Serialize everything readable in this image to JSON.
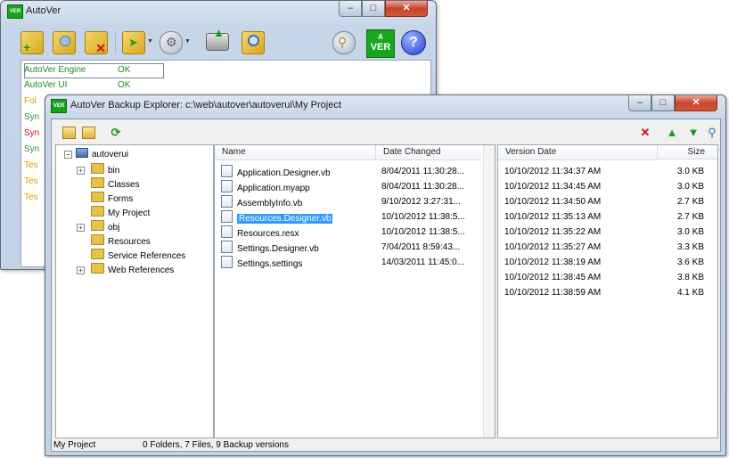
{
  "main_window": {
    "title": "AutoVer",
    "ver_badge": "VER",
    "ver_badge_small": "A",
    "status": [
      {
        "label": "AutoVer Engine",
        "value": "OK"
      },
      {
        "label": "AutoVer UI",
        "value": "OK"
      }
    ],
    "log_lines": [
      "Fol",
      "Syn",
      "Syn",
      "Syn",
      "Tes",
      "Tes",
      "Tes"
    ],
    "log_colors": [
      "#d9a400",
      "#2e8b2e",
      "#d01010",
      "#2e8b2e",
      "#d9a400",
      "#d9a400",
      "#d9a400"
    ]
  },
  "explorer": {
    "title": "AutoVer Backup Explorer: c:\\web\\autover\\autoverui\\My Project",
    "tree": {
      "root": "autoverui",
      "items": [
        {
          "label": "bin",
          "expandable": true
        },
        {
          "label": "Classes",
          "expandable": false
        },
        {
          "label": "Forms",
          "expandable": false
        },
        {
          "label": "My Project",
          "expandable": false
        },
        {
          "label": "obj",
          "expandable": true
        },
        {
          "label": "Resources",
          "expandable": false
        },
        {
          "label": "Service References",
          "expandable": false
        },
        {
          "label": "Web References",
          "expandable": true
        }
      ]
    },
    "files": {
      "col_name": "Name",
      "col_date": "Date Changed",
      "rows": [
        {
          "name": "Application.Designer.vb",
          "date": "8/04/2011 11:30:28..."
        },
        {
          "name": "Application.myapp",
          "date": "8/04/2011 11:30:28..."
        },
        {
          "name": "AssemblyInfo.vb",
          "date": "9/10/2012 3:27:31..."
        },
        {
          "name": "Resources.Designer.vb",
          "date": "10/10/2012 11:38:5..."
        },
        {
          "name": "Resources.resx",
          "date": "10/10/2012 11:38:5..."
        },
        {
          "name": "Settings.Designer.vb",
          "date": "7/04/2011 8:59:43..."
        },
        {
          "name": "Settings.settings",
          "date": "14/03/2011 11:45:0..."
        }
      ],
      "selected_index": 3
    },
    "versions": {
      "col_date": "Version Date",
      "col_size": "Size",
      "rows": [
        {
          "date": "10/10/2012 11:34:37 AM",
          "size": "3.0 KB"
        },
        {
          "date": "10/10/2012 11:34:45 AM",
          "size": "3.0 KB"
        },
        {
          "date": "10/10/2012 11:34:50 AM",
          "size": "2.7 KB"
        },
        {
          "date": "10/10/2012 11:35:13 AM",
          "size": "2.7 KB"
        },
        {
          "date": "10/10/2012 11:35:22 AM",
          "size": "3.0 KB"
        },
        {
          "date": "10/10/2012 11:35:27 AM",
          "size": "3.3 KB"
        },
        {
          "date": "10/10/2012 11:38:19 AM",
          "size": "3.6 KB"
        },
        {
          "date": "10/10/2012 11:38:45 AM",
          "size": "3.8 KB"
        },
        {
          "date": "10/10/2012 11:38:59 AM",
          "size": "4.1 KB"
        }
      ]
    },
    "statusbar": {
      "path": "My Project",
      "summary": "0 Folders, 7 Files, 9 Backup versions"
    }
  },
  "colors": {
    "selection": "#3399ff",
    "status_ok": "#1f8a1f",
    "close_button": "#c8452c"
  }
}
